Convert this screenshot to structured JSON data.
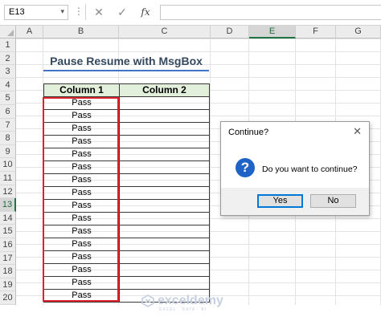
{
  "formula_bar": {
    "name_box": "E13",
    "fx_label": "fx",
    "formula": ""
  },
  "columns": [
    "A",
    "B",
    "C",
    "D",
    "E",
    "F",
    "G"
  ],
  "selected_column": "E",
  "rows": [
    "1",
    "2",
    "3",
    "4",
    "5",
    "6",
    "7",
    "8",
    "9",
    "10",
    "11",
    "12",
    "13",
    "14",
    "15",
    "16",
    "17",
    "18",
    "19",
    "20"
  ],
  "selected_row": "13",
  "sheet": {
    "title": "Pause Resume with MsgBox",
    "table_headers": [
      "Column 1",
      "Column 2"
    ],
    "column1_values": [
      "Pass",
      "Pass",
      "Pass",
      "Pass",
      "Pass",
      "Pass",
      "Pass",
      "Pass",
      "Pass",
      "Pass",
      "Pass",
      "Pass",
      "Pass",
      "Pass",
      "Pass",
      "Pass"
    ]
  },
  "dialog": {
    "title": "Continue?",
    "message": "Do you want to continue?",
    "yes_label": "Yes",
    "no_label": "No",
    "icon": "question-icon"
  },
  "watermark": {
    "name": "exceldemy",
    "tagline": "EXCEL · DATA · BI"
  },
  "colors": {
    "header_fill": "#e2efda",
    "highlight_border": "#e0202a",
    "title_underline": "#4472c4",
    "selection_green": "#217346"
  }
}
